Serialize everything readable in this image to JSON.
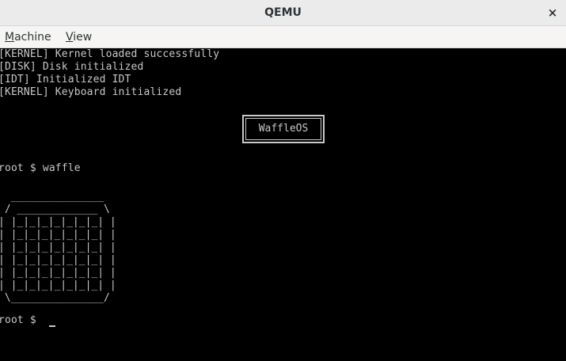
{
  "window": {
    "title": "QEMU",
    "close_label": "×"
  },
  "menu": {
    "machine_mnemonic": "M",
    "machine_rest": "achine",
    "view_mnemonic": "V",
    "view_rest": "iew"
  },
  "console": {
    "lines": [
      "[KERNEL] Kernel loaded successfully",
      "[DISK] Disk initialized",
      "[IDT] Initialized IDT",
      "[KERNEL] Keyboard initialized"
    ],
    "logo_text": "WaffleOS",
    "command_line": "root $ waffle",
    "prompt_line": "root $ ",
    "waffle_art": "  _______________\n / _____________ \\\n| |_|_|_|_|_|_|_| |\n| |_|_|_|_|_|_|_| |\n| |_|_|_|_|_|_|_| |\n| |_|_|_|_|_|_|_| |\n| |_|_|_|_|_|_|_| |\n| |_|_|_|_|_|_|_| |\n \\_______________/"
  }
}
